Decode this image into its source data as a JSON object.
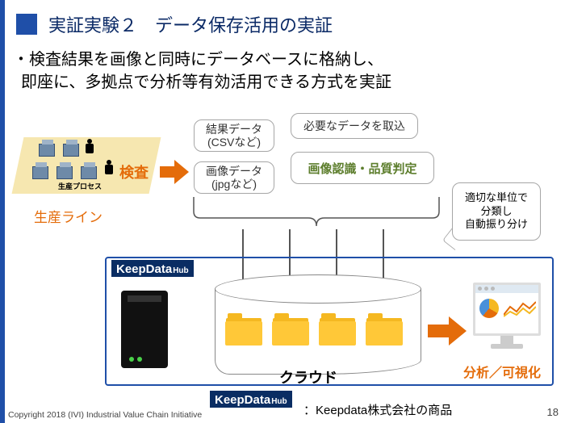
{
  "title": "実証実験２　データ保存活用の実証",
  "lead": {
    "l1": "・検査結果を画像と同時にデータベースに格納し、",
    "l2": "即座に、多拠点で分析等有効活用できる方式を実証"
  },
  "production": {
    "small_label": "生産プロセス",
    "label": "生産ライン",
    "kensa": "検査"
  },
  "boxes": {
    "csv_line1": "結果データ",
    "csv_line2": "(CSVなど)",
    "jpg_line1": "画像データ",
    "jpg_line2": "(jpgなど)",
    "import": "必要なデータを取込",
    "recog": "画像認識・品質判定"
  },
  "callout": "適切な単位で\n分類し\n自動振り分け",
  "platform": {
    "badge_main": "KeepData",
    "badge_sub": "Hub",
    "cloud": "クラウド",
    "analysis": "分析／可視化"
  },
  "footer": {
    "copyright": "Copyright 2018 (IVI) Industrial Value Chain Initiative",
    "note": "：Keepdata株式会社の商品",
    "page": "18"
  }
}
